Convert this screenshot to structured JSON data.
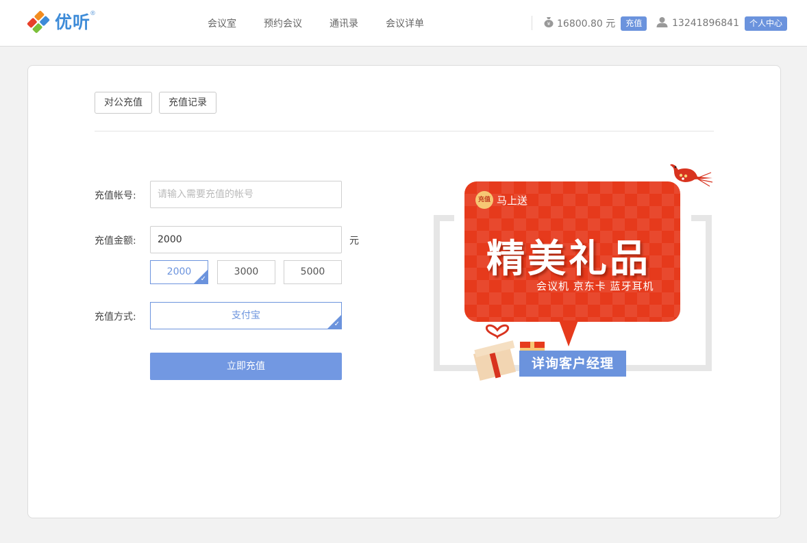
{
  "header": {
    "logo_text": "优听",
    "logo_reg": "®",
    "nav": [
      "会议室",
      "预约会议",
      "通讯录",
      "会议详单"
    ],
    "balance_text": "16800.80 元",
    "recharge_label": "充值",
    "phone": "13241896841",
    "profile_label": "个人中心"
  },
  "tabs": [
    "对公充值",
    "充值记录"
  ],
  "form": {
    "account_label": "充值帐号:",
    "account_placeholder": "请输入需要充值的帐号",
    "amount_label": "充值金额:",
    "amount_value": "2000",
    "amount_unit": "元",
    "presets": [
      "2000",
      "3000",
      "5000"
    ],
    "selected_preset": "2000",
    "method_label": "充值方式:",
    "method_value": "支付宝",
    "submit_label": "立即充值"
  },
  "promo": {
    "badge": "充值",
    "tag": "马上送",
    "headline": "精美礼品",
    "items": "会议机  京东卡  蓝牙耳机",
    "cta": "详询客户经理"
  },
  "colors": {
    "accent": "#6b93dd",
    "promo_red": "#e63a1c",
    "logo_blue": "#3d8bd8"
  }
}
